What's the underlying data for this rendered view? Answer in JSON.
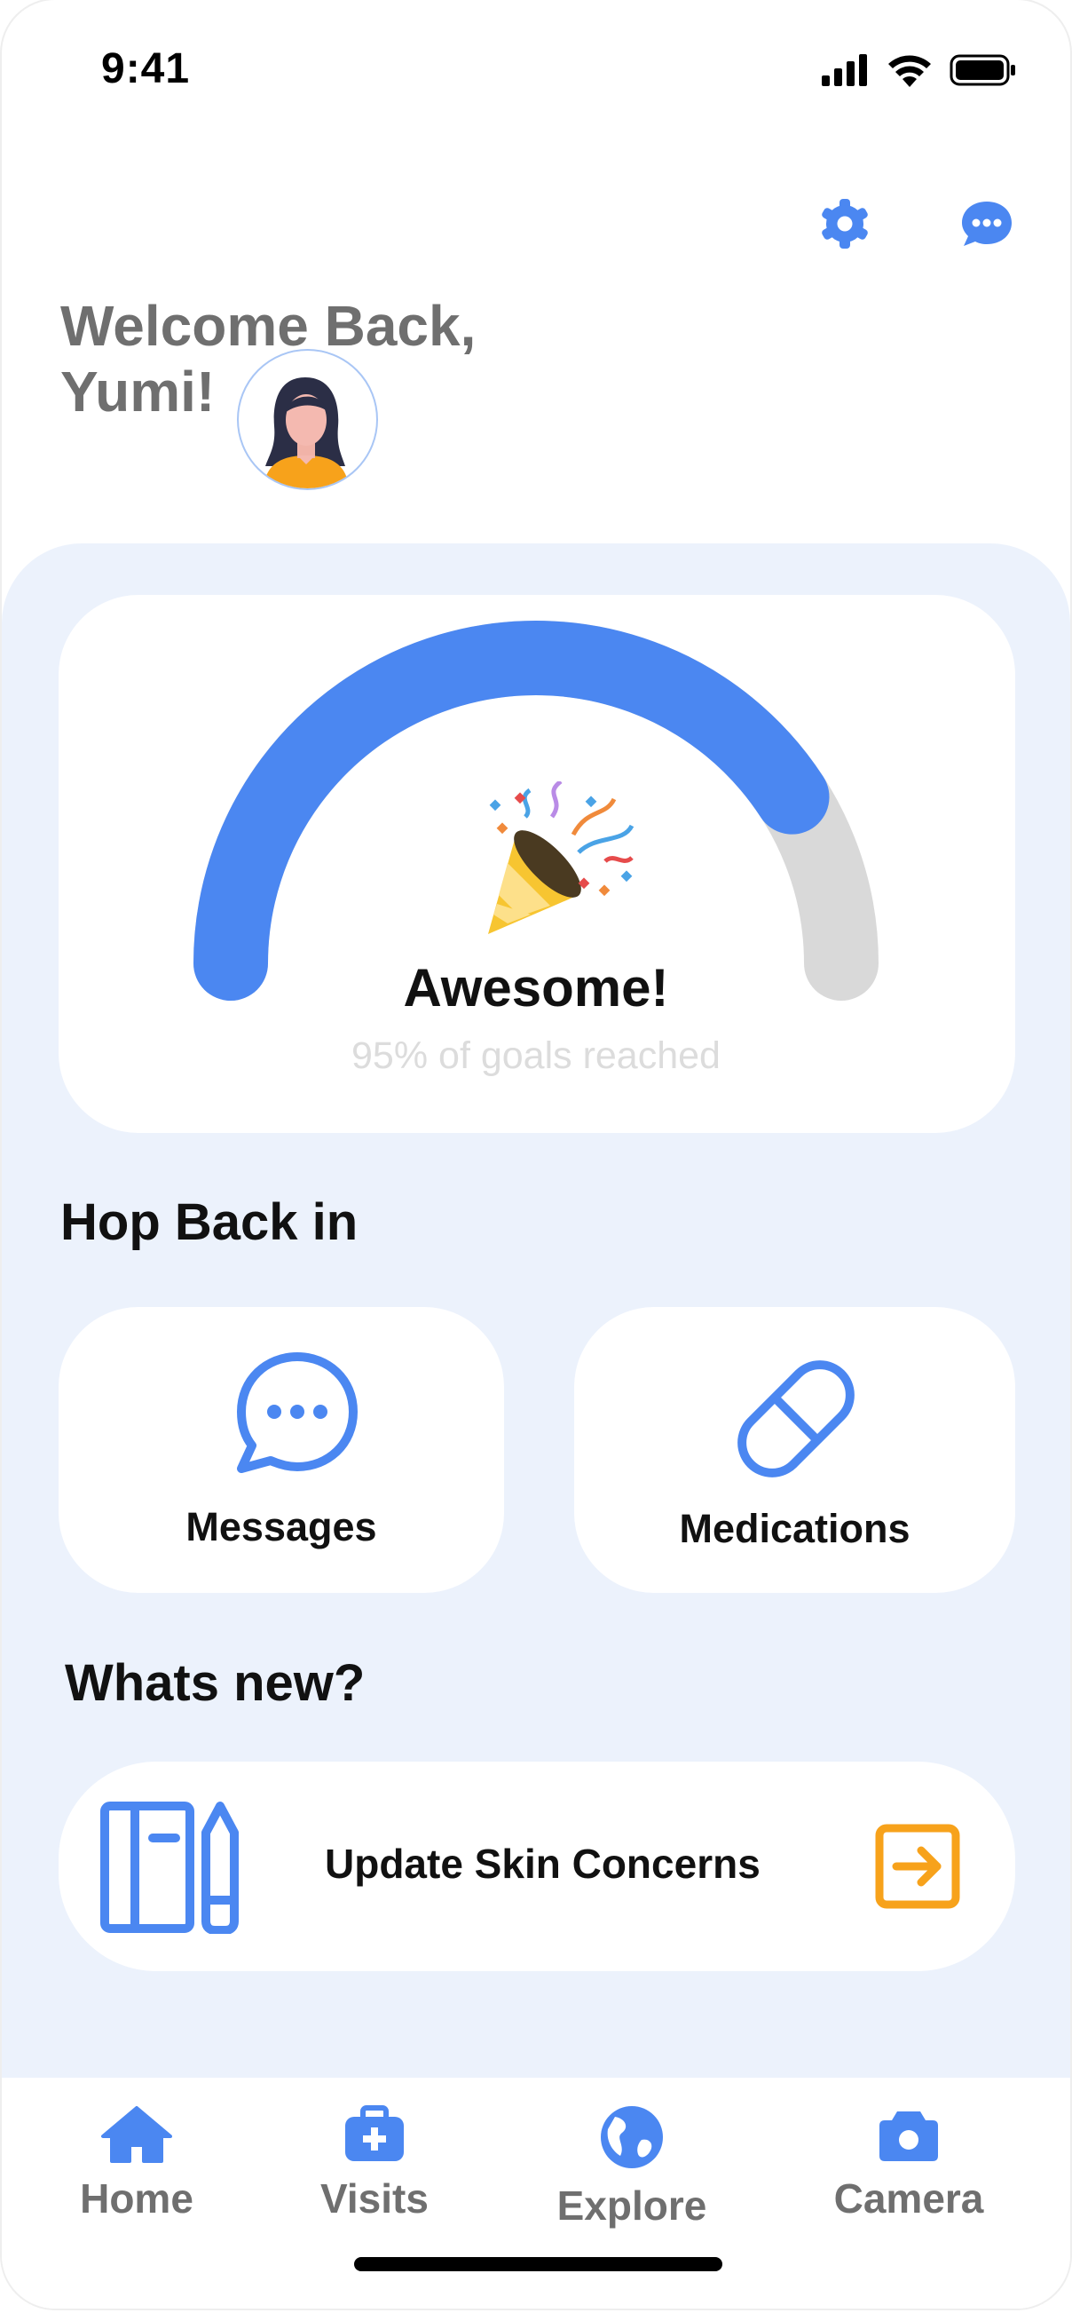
{
  "status_bar": {
    "time": "9:41"
  },
  "header": {
    "greeting_line1": "Welcome Back,",
    "greeting_line2": "Yumi!",
    "settings_icon": "gear-icon",
    "chat_icon": "chat-icon"
  },
  "goal": {
    "title": "Awesome!",
    "subtitle": "95% of goals reached",
    "progress": 0.95,
    "accent_color": "#4b87f1",
    "track_color": "#d9d9d9"
  },
  "hop_back": {
    "title": "Hop Back in",
    "items": [
      {
        "label": "Messages",
        "icon": "message-bubble-icon"
      },
      {
        "label": "Medications",
        "icon": "pill-icon"
      }
    ]
  },
  "whats_new": {
    "title": "Whats new?",
    "item_label": "Update Skin Concerns",
    "item_icon": "notebook-pencil-icon",
    "arrow_icon": "arrow-right-box-icon",
    "arrow_color": "#f7a21b"
  },
  "tabbar": {
    "items": [
      {
        "label": "Home",
        "icon": "home-icon"
      },
      {
        "label": "Visits",
        "icon": "medical-kit-icon"
      },
      {
        "label": "Explore",
        "icon": "globe-icon"
      },
      {
        "label": "Camera",
        "icon": "camera-icon"
      }
    ]
  }
}
